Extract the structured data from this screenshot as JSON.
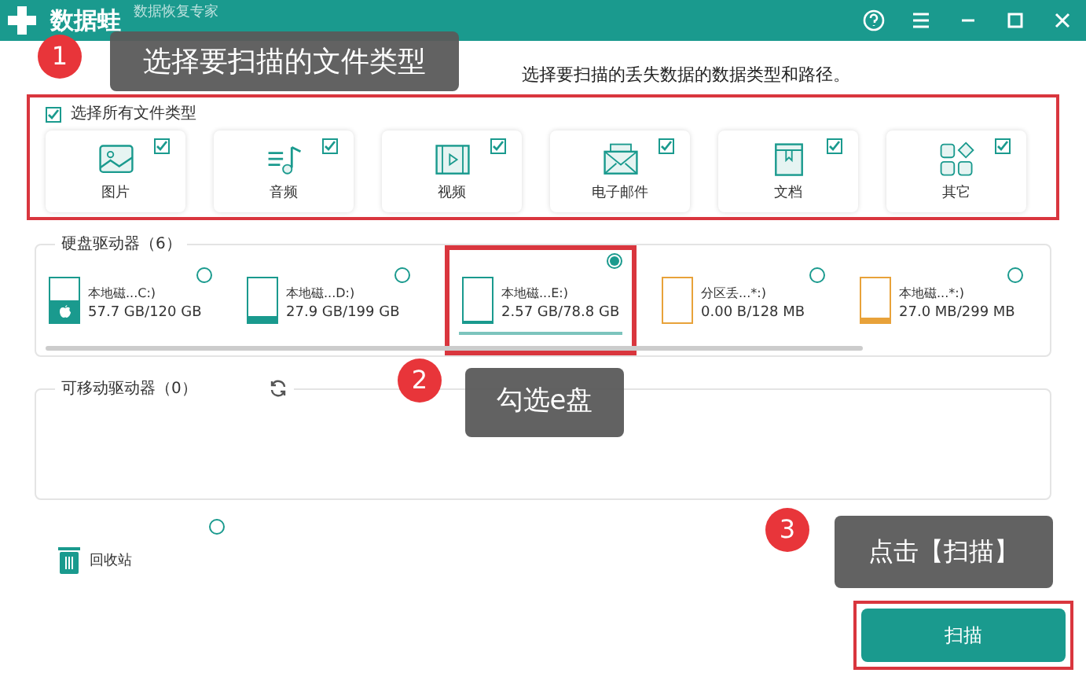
{
  "window": {
    "app_name": "数据蛙",
    "subtitle": "数据恢复专家"
  },
  "instruction": "选择要扫描的丢失数据的数据类型和路径。",
  "file_types": {
    "select_all": {
      "label": "选择所有文件类型",
      "checked": true
    },
    "items": [
      {
        "kind": "image",
        "label": "图片",
        "checked": true
      },
      {
        "kind": "audio",
        "label": "音频",
        "checked": true
      },
      {
        "kind": "video",
        "label": "视频",
        "checked": true
      },
      {
        "kind": "email",
        "label": "电子邮件",
        "checked": true
      },
      {
        "kind": "document",
        "label": "文档",
        "checked": true
      },
      {
        "kind": "other",
        "label": "其它",
        "checked": true
      }
    ]
  },
  "hard_drives": {
    "title": "硬盘驱动器（6）",
    "items": [
      {
        "name": "本地磁...C:)",
        "size": "57.7 GB/120 GB",
        "level": 0.48,
        "color": "#1a9a8e",
        "system": true,
        "selected": false
      },
      {
        "name": "本地磁...D:)",
        "size": "27.9 GB/199 GB",
        "level": 0.14,
        "color": "#1a9a8e",
        "system": false,
        "selected": false
      },
      {
        "name": "本地磁...E:)",
        "size": "2.57 GB/78.8 GB",
        "level": 0.03,
        "color": "#1a9a8e",
        "system": false,
        "selected": true
      },
      {
        "name": "分区丢...*:)",
        "size": "0.00  B/128 MB",
        "level": 0,
        "color": "#e8a23a",
        "system": false,
        "selected": false
      },
      {
        "name": "本地磁...*:)",
        "size": "27.0 MB/299 MB",
        "level": 0.09,
        "color": "#e8a23a",
        "system": false,
        "selected": false
      }
    ]
  },
  "removable_drives": {
    "title": "可移动驱动器（0）"
  },
  "recycle_bin": {
    "label": "回收站",
    "selected": false
  },
  "scan_button": "扫描",
  "callouts": [
    {
      "number": "1",
      "text": "选择要扫描的文件类型"
    },
    {
      "number": "2",
      "text": "勾选e盘"
    },
    {
      "number": "3",
      "text": "点击【扫描】"
    }
  ]
}
